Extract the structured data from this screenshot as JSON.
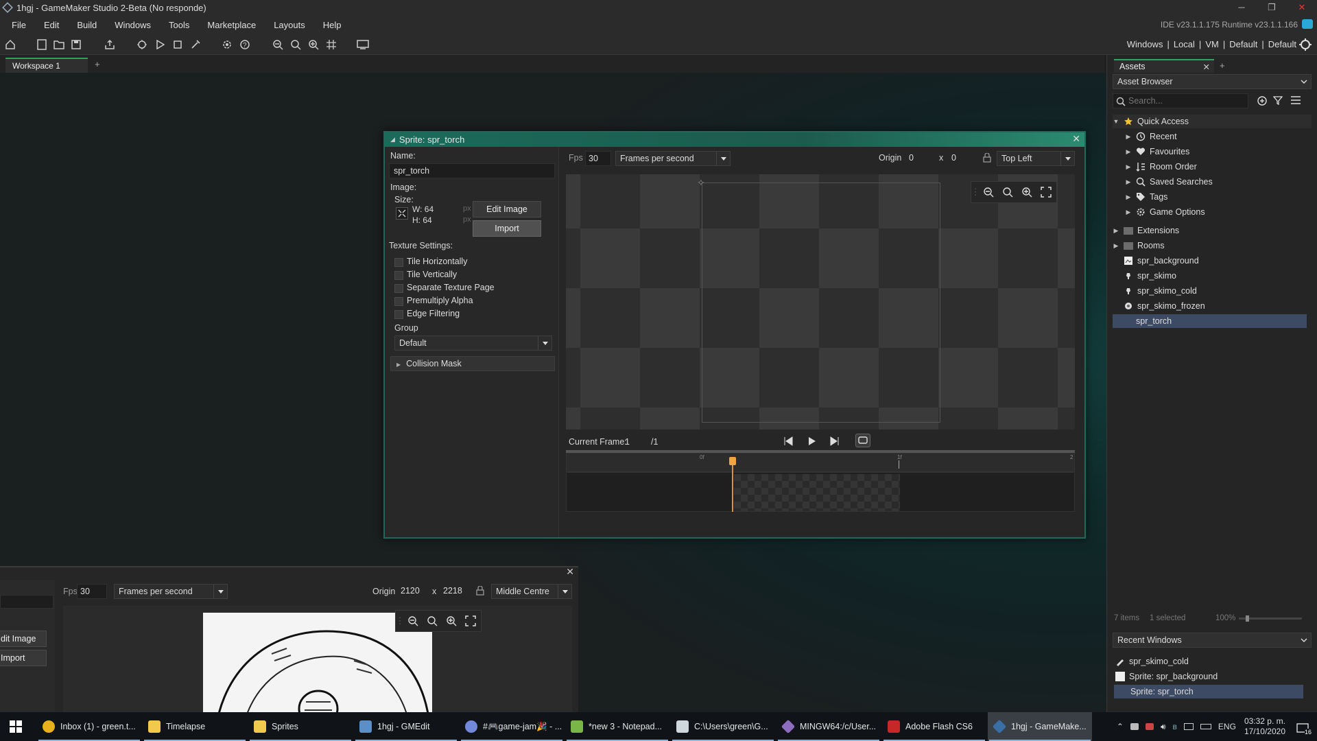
{
  "window": {
    "title": "1hgj - GameMaker Studio 2-Beta (No responde)",
    "minimize": "─",
    "maximize": "❐",
    "close": "✕"
  },
  "menu": [
    "File",
    "Edit",
    "Build",
    "Windows",
    "Tools",
    "Marketplace",
    "Layouts",
    "Help"
  ],
  "ide_version": "IDE v23.1.1.175  Runtime v23.1.1.166",
  "target_bar": [
    "Windows",
    "|",
    "Local",
    "|",
    "VM",
    "|",
    "Default",
    "|",
    "Default"
  ],
  "workspace_tab": {
    "label": "Workspace 1",
    "add": "+"
  },
  "sprite_editor": {
    "title": "Sprite: spr_torch",
    "name_label": "Name:",
    "name_value": "spr_torch",
    "image_label": "Image:",
    "size_label": "Size:",
    "width": "W: 64",
    "height": "H: 64",
    "px": "px",
    "edit_image": "Edit Image",
    "import": "Import",
    "texture_settings_label": "Texture Settings:",
    "texture_options": [
      {
        "label": "Tile Horizontally",
        "checked": false
      },
      {
        "label": "Tile Vertically",
        "checked": false
      },
      {
        "label": "Separate Texture Page",
        "checked": false
      },
      {
        "label": "Premultiply Alpha",
        "checked": false
      },
      {
        "label": "Edge Filtering",
        "checked": false
      }
    ],
    "group_label": "Group",
    "group_value": "Default",
    "collision_mask": "Collision Mask",
    "fps_label": "Fps",
    "fps_value": "30",
    "fps_mode": "Frames per second",
    "origin_label": "Origin",
    "origin_x": "0",
    "origin_sep": "x",
    "origin_y": "0",
    "origin_preset": "Top Left",
    "current_frame_label": "Current Frame:",
    "current_frame_value": "1",
    "frame_total": "/1",
    "timeline_marks": [
      "0f",
      "1f",
      "2"
    ]
  },
  "sprite_editor_2": {
    "fps_label": "Fps",
    "fps_value": "30",
    "fps_mode": "Frames per second",
    "origin_label": "Origin",
    "origin_x": "2120",
    "origin_sep": "x",
    "origin_y": "2218",
    "origin_preset": "Middle Centre",
    "edit_image": "dit Image",
    "import": "Import"
  },
  "assets_panel": {
    "tab": "Assets",
    "add": "+",
    "browser_title": "Asset Browser",
    "search_placeholder": "Search...",
    "quick_access": "Quick Access",
    "quick_items": [
      "Recent",
      "Favourites",
      "Room Order",
      "Saved Searches",
      "Tags",
      "Game Options"
    ],
    "folders": [
      "Extensions",
      "Rooms"
    ],
    "sprites": [
      "spr_background",
      "spr_skimo",
      "spr_skimo_cold",
      "spr_skimo_frozen",
      "spr_torch"
    ],
    "selected": "spr_torch",
    "status_items": "7 items",
    "status_selected": "1 selected",
    "zoom": "100%",
    "recent_windows_title": "Recent Windows",
    "recent_windows": [
      "spr_skimo_cold",
      "Sprite: spr_background",
      "Sprite: spr_torch"
    ]
  },
  "taskbar": {
    "items": [
      {
        "label": "Inbox (1) - green.t...",
        "color": "#e9b21d"
      },
      {
        "label": "Timelapse",
        "color": "#f2c94c"
      },
      {
        "label": "Sprites",
        "color": "#f2c94c"
      },
      {
        "label": "1hgj - GMEdit",
        "color": "#5a8fc8"
      },
      {
        "label": "#🎮game-jam🎉 - ...",
        "color": "#7289da"
      },
      {
        "label": "*new 3 - Notepad...",
        "color": "#7ab547"
      },
      {
        "label": "C:\\Users\\green\\G...",
        "color": "#cfd8dc"
      },
      {
        "label": "MINGW64:/c/User...",
        "color": "#8e6cc0"
      },
      {
        "label": "Adobe Flash CS6",
        "color": "#c62828"
      },
      {
        "label": "1hgj - GameMake...",
        "color": "#3b6ea5"
      }
    ],
    "lang": "ENG",
    "time": "03:32 p. m.",
    "date": "17/10/2020",
    "notif_count": "16"
  }
}
